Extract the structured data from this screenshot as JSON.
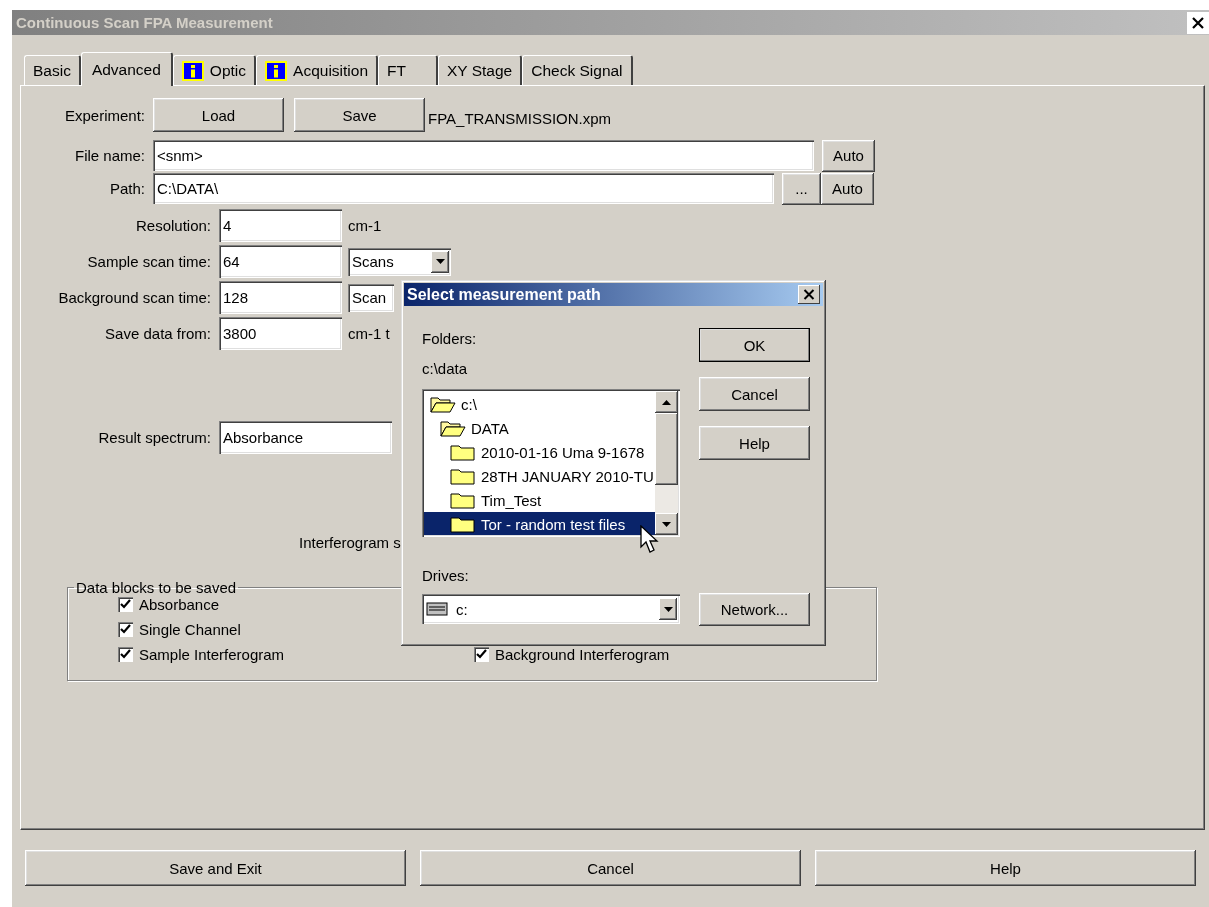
{
  "window": {
    "title": "Continuous Scan FPA Measurement"
  },
  "tabs": [
    {
      "label": "Basic",
      "selected": false,
      "info": false
    },
    {
      "label": "Advanced",
      "selected": true,
      "info": false
    },
    {
      "label": "Optic",
      "selected": false,
      "info": true
    },
    {
      "label": "Acquisition",
      "selected": false,
      "info": true
    },
    {
      "label": "FT",
      "selected": false,
      "info": false
    },
    {
      "label": "XY Stage",
      "selected": false,
      "info": false
    },
    {
      "label": "Check Signal",
      "selected": false,
      "info": false
    }
  ],
  "experiment": {
    "label": "Experiment:",
    "load": "Load",
    "save": "Save",
    "file": "FPA_TRANSMISSION.xpm"
  },
  "file_name": {
    "label": "File name:",
    "value": "<snm>",
    "auto": "Auto"
  },
  "path": {
    "label": "Path:",
    "value": "C:\\DATA\\",
    "browse": "...",
    "auto": "Auto"
  },
  "fields": [
    {
      "label": "Resolution:",
      "value": "4",
      "kind": "unit",
      "unit": "cm-1"
    },
    {
      "label": "Sample scan time:",
      "value": "64",
      "kind": "select",
      "unit": "Scans"
    },
    {
      "label": "Background scan time:",
      "value": "128",
      "kind": "partial",
      "unit": "Scan"
    },
    {
      "label": "Save data from:",
      "value": "3800",
      "kind": "unit",
      "unit": "cm-1 t"
    }
  ],
  "result": {
    "label": "Result spectrum:",
    "value": "Absorbance"
  },
  "interferogram_label": "Interferogram s",
  "data_blocks": {
    "title": "Data blocks to be saved",
    "items": [
      {
        "label": "Absorbance",
        "checked": true
      },
      {
        "label": "Single Channel",
        "checked": true
      },
      {
        "label": "Sample Interferogram",
        "checked": true
      },
      {
        "label": "Background Interferogram",
        "checked": true
      }
    ]
  },
  "dialog": {
    "title": "Select measurement path",
    "folders_label": "Folders:",
    "current": "c:\\data",
    "tree": [
      {
        "label": "c:\\",
        "expanded": true,
        "selected": false,
        "children": [
          {
            "label": "DATA",
            "expanded": true,
            "selected": false,
            "children": [
              {
                "label": "2010-01-16 Uma 9-1678",
                "expanded": false,
                "selected": false
              },
              {
                "label": "28TH JANUARY 2010-TU",
                "expanded": false,
                "selected": false
              },
              {
                "label": "Tim_Test",
                "expanded": false,
                "selected": false
              },
              {
                "label": "Tor - random test files",
                "expanded": false,
                "selected": true
              }
            ]
          }
        ]
      }
    ],
    "drives_label": "Drives:",
    "drive": "c:",
    "buttons": [
      {
        "label": "OK",
        "default": true
      },
      {
        "label": "Cancel",
        "default": false
      },
      {
        "label": "Help",
        "default": false
      }
    ],
    "network": "Network..."
  },
  "footer": [
    "Save and Exit",
    "Cancel",
    "Help"
  ]
}
